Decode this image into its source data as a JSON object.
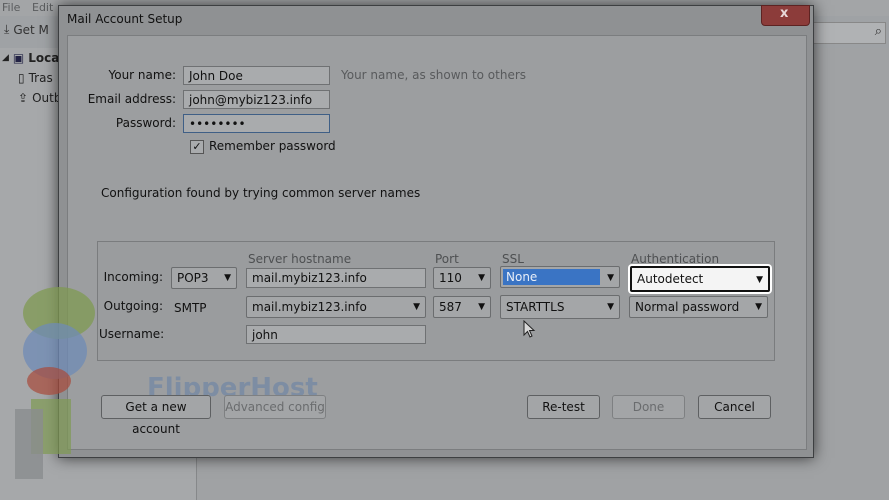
{
  "background": {
    "menu": [
      "File",
      "Edit"
    ],
    "toolbar_button": "Get M",
    "folders": [
      "Local",
      "Tras",
      "Outb"
    ]
  },
  "dialog": {
    "title": "Mail Account Setup",
    "close_symbol": "x",
    "fields": {
      "name_label": "Your name:",
      "name_value": "John Doe",
      "name_hint": "Your name, as shown to others",
      "email_label": "Email address:",
      "email_value": "john@mybiz123.info",
      "password_label": "Password:",
      "password_value": "••••••••",
      "remember_label": "Remember password",
      "remember_checked": true
    },
    "status": "Configuration found by trying common server names",
    "server_table": {
      "headers": {
        "hostname": "Server hostname",
        "port": "Port",
        "ssl": "SSL",
        "auth": "Authentication"
      },
      "incoming": {
        "label": "Incoming:",
        "protocol": "POP3",
        "hostname": "mail.mybiz123.info",
        "port": "110",
        "ssl": "None",
        "auth": "Autodetect"
      },
      "outgoing": {
        "label": "Outgoing:",
        "protocol": "SMTP",
        "hostname": "mail.mybiz123.info",
        "port": "587",
        "ssl": "STARTTLS",
        "auth": "Normal password"
      },
      "username": {
        "label": "Username:",
        "value": "john"
      }
    },
    "buttons": {
      "new_account": "Get a new account",
      "advanced": "Advanced config",
      "retest": "Re-test",
      "done": "Done",
      "cancel": "Cancel"
    },
    "watermark": "FlipperHost"
  },
  "colors": {
    "selection": "#3a74c4",
    "dialog_bg": "#9c9ea0"
  }
}
